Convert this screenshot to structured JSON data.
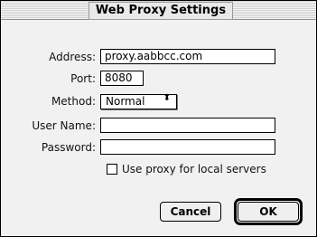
{
  "window": {
    "title": "Web Proxy Settings"
  },
  "form": {
    "address": {
      "label": "Address:",
      "value": "proxy.aabbcc.com"
    },
    "port": {
      "label": "Port:",
      "value": "8080"
    },
    "method": {
      "label": "Method:",
      "value": "Normal",
      "arrows": "⬍"
    },
    "user_name": {
      "label": "User Name:",
      "value": ""
    },
    "password": {
      "label": "Password:",
      "value": ""
    },
    "use_proxy_local": {
      "label": "Use proxy for local servers",
      "checked": false
    }
  },
  "buttons": {
    "cancel": "Cancel",
    "ok": "OK"
  }
}
